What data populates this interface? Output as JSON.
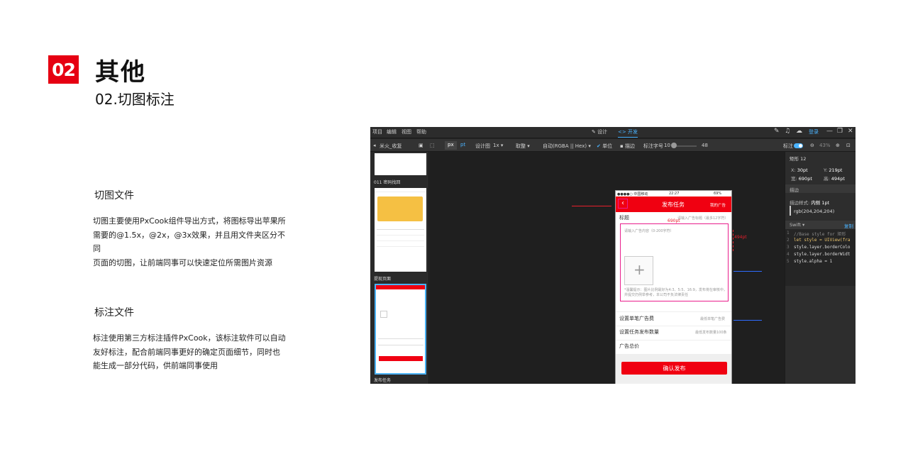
{
  "header": {
    "badge": "02",
    "title": "其他",
    "subtitle": "02.切图标注"
  },
  "sections": [
    {
      "title": "切图文件",
      "lines": [
        "切图主要使用PxCook组件导出方式，将图标导出苹果所",
        "需要的@1.5x，@2x，@3x效果，并且用文件夹区分不同",
        "页面的切图，让前端同事可以快速定位所需图片资源"
      ]
    },
    {
      "title": "标注文件",
      "lines": [
        "标注使用第三方标注插件PxCook，该标注软件可以自动",
        "友好标注，配合前端同事更好的确定页面细节，同时也",
        "能生成一部分代码，供前端同事使用"
      ]
    }
  ],
  "app": {
    "menu": [
      "项目",
      "编辑",
      "视图",
      "帮助"
    ],
    "modes": {
      "design": "设计",
      "dev": "开发"
    },
    "login": "登录",
    "toolbar": {
      "project": "米火_收复",
      "unit_px": "px",
      "unit_pt": "pt",
      "design_label": "设计图",
      "design_value": "1x",
      "round_label": "取整",
      "color_format": "自动(RGBA || Hex)",
      "unit_check": "单位",
      "stroke_check": "描边",
      "font_label": "标注字号",
      "font_min": "10",
      "font_max": "48",
      "annot_label": "标注",
      "zoom": "43%"
    },
    "pages": [
      {
        "label": "011 密码找回"
      },
      {
        "label": "提现页面"
      },
      {
        "label": "发布任务"
      }
    ],
    "inspector": {
      "layer": "矩形 12",
      "x_label": "X:",
      "x": "30pt",
      "y_label": "Y:",
      "y": "219pt",
      "w_label": "宽:",
      "w": "690pt",
      "h_label": "高:",
      "h": "494pt",
      "stroke_section": "描边",
      "stroke_style_label": "描边样式:",
      "stroke_style": "内侧",
      "stroke_width": "1pt",
      "stroke_color": "rgb(204,204,204)",
      "code_lang": "Swift",
      "copy": "复制",
      "code": [
        "//Base style for 矩形",
        "let style = UIView(fra",
        "style.layer.borderColo",
        "style.layer.borderWidt",
        "style.alpha = 1"
      ]
    },
    "phone": {
      "carrier": "●●●●○ 中国移动",
      "time": "22:27",
      "battery": "69%",
      "nav_title": "发布任务",
      "nav_right": "我的广告",
      "title_label": "标题",
      "title_placeholder": "请输入广告标题（最多12字符）",
      "content_placeholder": "请输入广告内容（0-200字符）",
      "upload_hint": "*温馨提示：图片比例最好为4:3、5:5、16:9，发布将在审核中，并提交仍例举参考，本公司不负法律责任",
      "fee_label": "设置单笔广告费",
      "fee_hint": "最低单笔广告费",
      "count_label": "设置任务发布数量",
      "count_hint": "最低发布数量100条",
      "total_label": "广告总价",
      "confirm": "确认发布",
      "dim_w": "690pt",
      "dim_h": "494pt"
    }
  },
  "colors": {
    "accent": "#e60012",
    "app_blue": "#4ab3ff",
    "app_red": "#f00011"
  }
}
